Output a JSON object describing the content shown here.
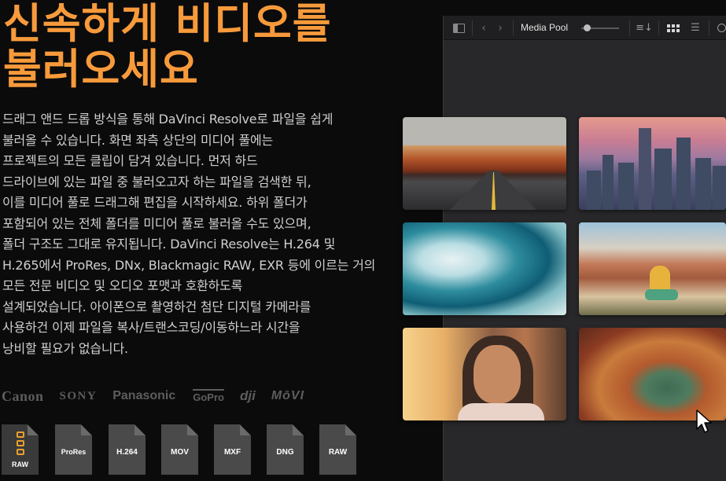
{
  "headline": {
    "line1": "신속하게 비디오를",
    "line2": "불러오세요"
  },
  "body": {
    "lines": [
      "드래그 앤드 드롭 방식을 통해 DaVinci Resolve로 파일을 쉽게",
      "불러올 수 있습니다. 화면 좌측 상단의 미디어 풀에는",
      "프로젝트의 모든 클립이 담겨 있습니다. 먼저 하드",
      "드라이브에 있는 파일 중 불러오고자 하는 파일을 검색한 뒤,",
      "이를 미디어 풀로 드래그해 편집을 시작하세요. 하위 폴더가",
      "포함되어 있는 전체 폴더를 미디어 풀로 불러올 수도 있으며,",
      "폴더 구조도 그대로 유지됩니다. DaVinci Resolve는 H.264 및",
      "H.265에서 ProRes, DNx, Blackmagic RAW, EXR 등에 이르는 거의",
      "모든 전문 비디오 및 오디오 포맷과 호환하도록",
      "설계되었습니다. 아이폰으로 촬영하건 첨단 디지털 카메라를",
      "사용하건 이제 파일을 복사/트랜스코딩/이동하느라 시간을",
      "낭비할 필요가 없습니다."
    ]
  },
  "brands": [
    "Canon",
    "SONY",
    "Panasonic",
    "GoPro",
    "dji",
    "MōVI"
  ],
  "formats": [
    "RAW",
    "ProRes",
    "H.264",
    "MOV",
    "MXF",
    "DNG",
    "RAW"
  ],
  "toolbar": {
    "title": "Media Pool",
    "back_icon": "‹",
    "forward_icon": "›",
    "sort_icon": "≡↓",
    "list_icon": "☰"
  },
  "colors": {
    "accent": "#f79a3b",
    "background": "#0b0b0c",
    "app_bg": "#28282a"
  },
  "icons": [
    "panel-toggle-icon",
    "back-icon",
    "forward-icon",
    "zoom-slider",
    "sort-icon",
    "grid-view-icon",
    "list-view-icon",
    "search-icon",
    "mouse-cursor-icon"
  ]
}
